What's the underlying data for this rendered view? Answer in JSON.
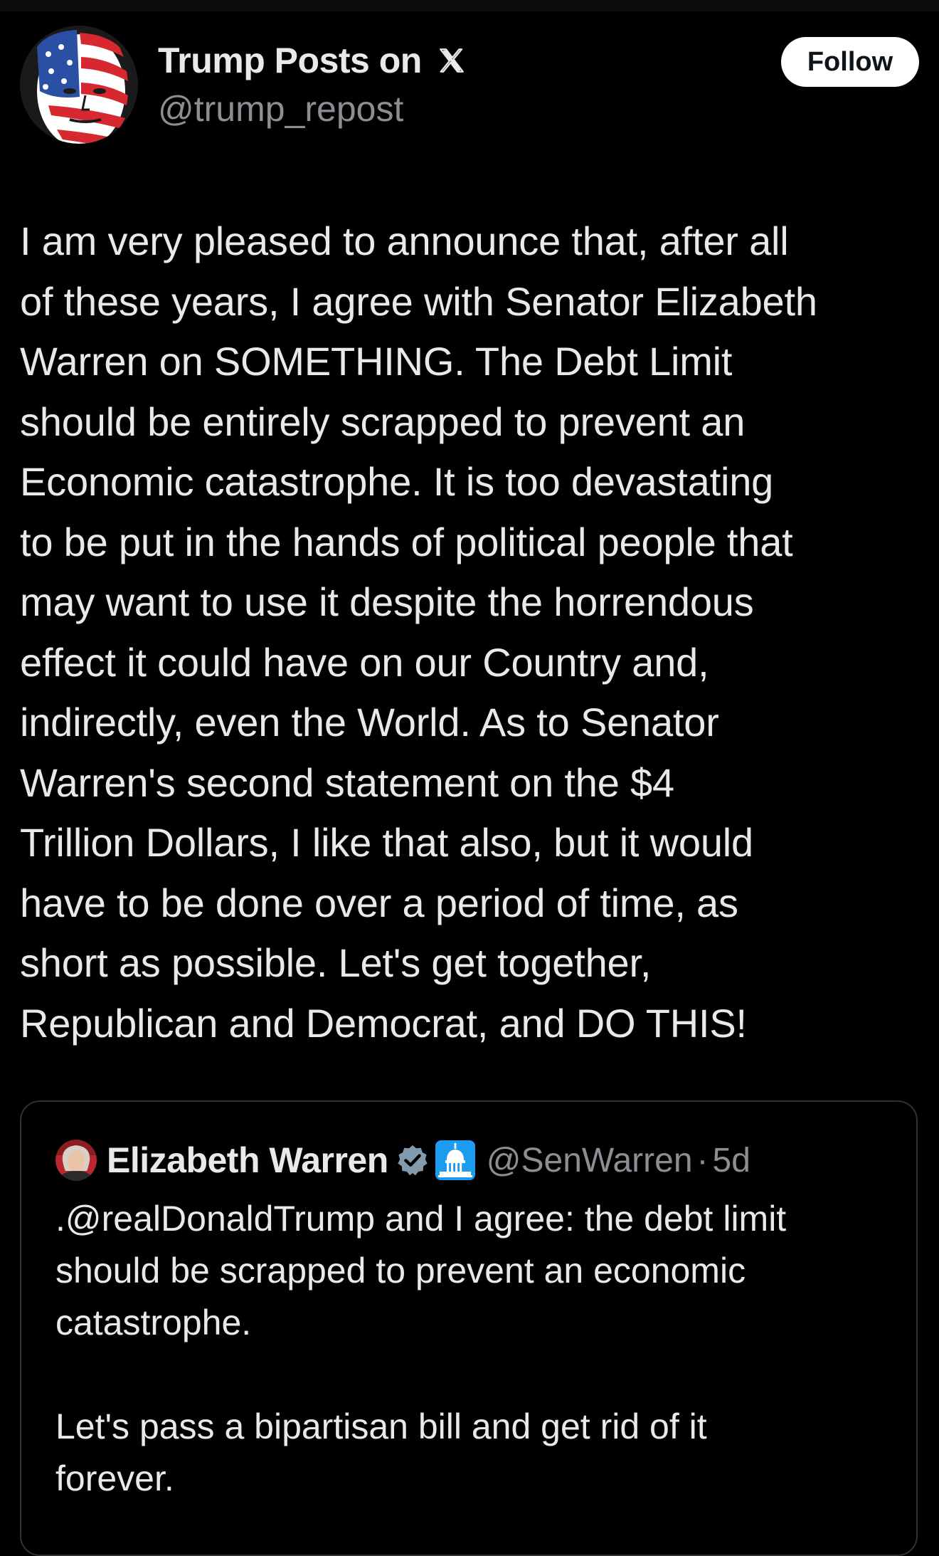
{
  "post": {
    "author": {
      "display_name": "Trump Posts on",
      "handle": "@trump_repost",
      "avatar_icon": "flag-face-avatar",
      "platform_icon": "x-logo-icon"
    },
    "follow_label": "Follow",
    "text": "I am very pleased to announce that, after all\nof these years, I agree with Senator Elizabeth\nWarren on SOMETHING. The Debt Limit\nshould be entirely scrapped to prevent an\nEconomic catastrophe. It is too devastating\nto be put in the hands of political people that\nmay want to use it despite the horrendous\neffect it could have on our Country and,\nindirectly, even the World. As to Senator\nWarren's second statement on the $4\nTrillion Dollars, I like that also, but it would\nhave to be done over a period of time, as\nshort as possible. Let's get together,\nRepublican and Democrat, and DO THIS!"
  },
  "quoted_post": {
    "author": {
      "display_name": "Elizabeth Warren",
      "handle": "@SenWarren",
      "separator": "·",
      "time": "5d",
      "badges": [
        "verified-badge-icon",
        "capitol-building-icon"
      ]
    },
    "text": ".@realDonaldTrump and I agree: the debt limit\nshould be scrapped to prevent an economic\ncatastrophe.\n\nLet's pass a bipartisan bill and get rid of it\nforever."
  },
  "colors": {
    "background": "#000000",
    "text_primary": "#e7e9ea",
    "text_secondary": "#8b8e92",
    "border": "#2f3336",
    "follow_bg": "#ffffff",
    "follow_text": "#0f1419",
    "verified_badge": "#829aab",
    "capitol_badge_bg": "#1d9bf0"
  }
}
